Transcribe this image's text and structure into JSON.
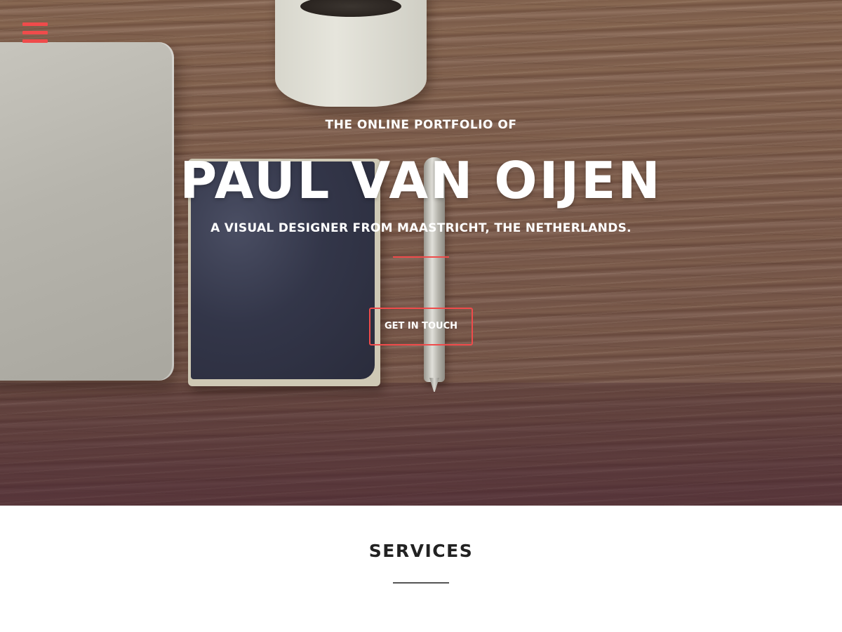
{
  "nav": {
    "menu_icon": "hamburger-menu-icon"
  },
  "hero": {
    "eyebrow": "THE ONLINE PORTFOLIO OF",
    "name": "PAUL VAN OIJEN",
    "tagline": "A VISUAL DESIGNER FROM MAASTRICHT, THE NETHERLANDS.",
    "cta_label": "GET IN TOUCH"
  },
  "services": {
    "title": "SERVICES"
  },
  "colors": {
    "accent": "#ef4b4b",
    "text_light": "#ffffff",
    "text_dark": "#222222",
    "divider_dark": "#555555"
  }
}
